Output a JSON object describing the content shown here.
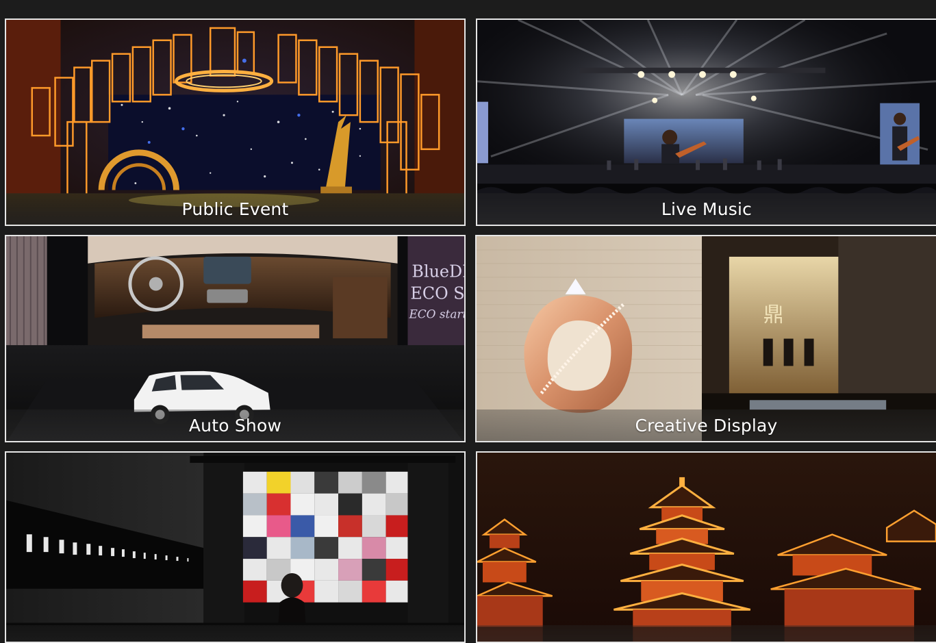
{
  "gallery": {
    "items": [
      {
        "label": "Public Event"
      },
      {
        "label": "Live Music"
      },
      {
        "label": "Auto Show"
      },
      {
        "label": "Creative Display"
      },
      {
        "label": ""
      },
      {
        "label": ""
      }
    ],
    "auto_show_screen_text": [
      "BlueDI",
      "ECO St",
      "ECO start"
    ]
  },
  "colors": {
    "page_background": "#1c1c1c",
    "card_border": "#e6e6e6",
    "caption_text": "#ffffff"
  }
}
